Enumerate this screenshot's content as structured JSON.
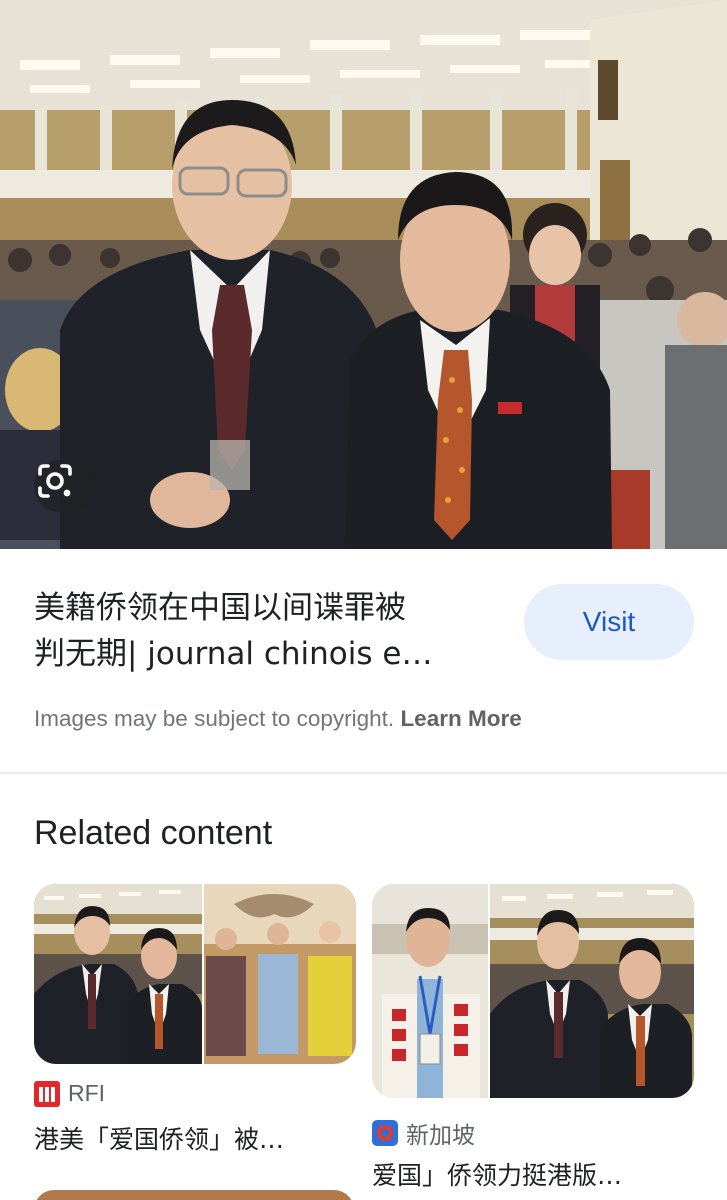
{
  "result": {
    "title_line1": "美籍侨领在中国以间谍罪被",
    "title_line2": "判无期| journal chinois e…",
    "visit_label": "Visit",
    "copyright_text": "Images may be subject to copyright. ",
    "learn_more": "Learn More"
  },
  "related": {
    "heading": "Related content",
    "items": [
      {
        "source": "RFI",
        "title": "港美「爱国侨领」被…",
        "favicon": "rfi-logo-icon"
      },
      {
        "source": "新加坡",
        "title": "爱国」侨领力挺港版…",
        "favicon": "circle-logo-icon"
      }
    ]
  },
  "icons": {
    "lens": "google-lens-icon"
  },
  "colors": {
    "accent": "#1a57c9",
    "visit_bg": "#e8effc",
    "rfi_red": "#e3262a"
  }
}
